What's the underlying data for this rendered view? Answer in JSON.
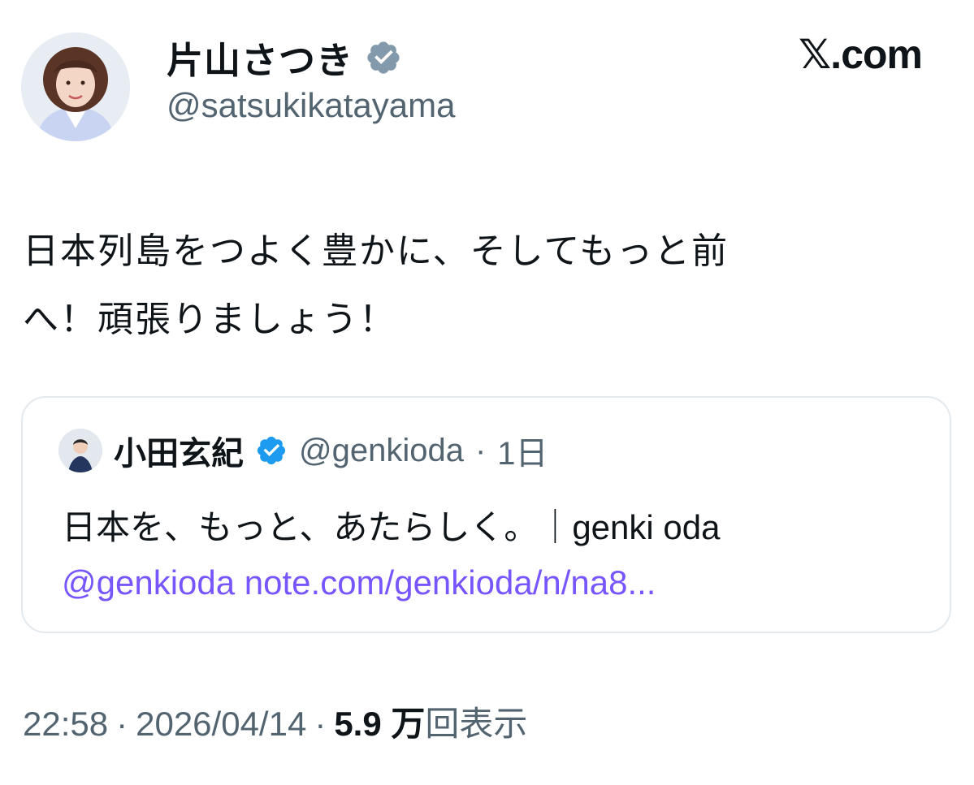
{
  "author": {
    "display_name": "片山さつき",
    "handle": "@satsukikatayama",
    "verified": "gray-verified-badge"
  },
  "brand": "𝕏.com",
  "tweet": {
    "line1": "日本列島をつよく豊かに、そしてもっと前",
    "line2": "へ！頑張りましょう！"
  },
  "quoted": {
    "display_name": "小田玄紀",
    "handle": "@genkioda",
    "separator": "·",
    "time": "1日",
    "text": "日本を、もっと、あたらしく。｜genki oda",
    "link": "@genkioda note.com/genkioda/n/na8..."
  },
  "meta": {
    "time": "22:58",
    "sep1": "·",
    "date": "2026/04/14",
    "sep2": "·",
    "views": "5.9 万",
    "views_label": "回表示"
  },
  "colors": {
    "text": "#0f1419",
    "secondary": "#536471",
    "link": "#7856ff",
    "verified_blue": "#1d9bf0",
    "verified_gray": "#829aab",
    "border": "#e4e9ee"
  }
}
